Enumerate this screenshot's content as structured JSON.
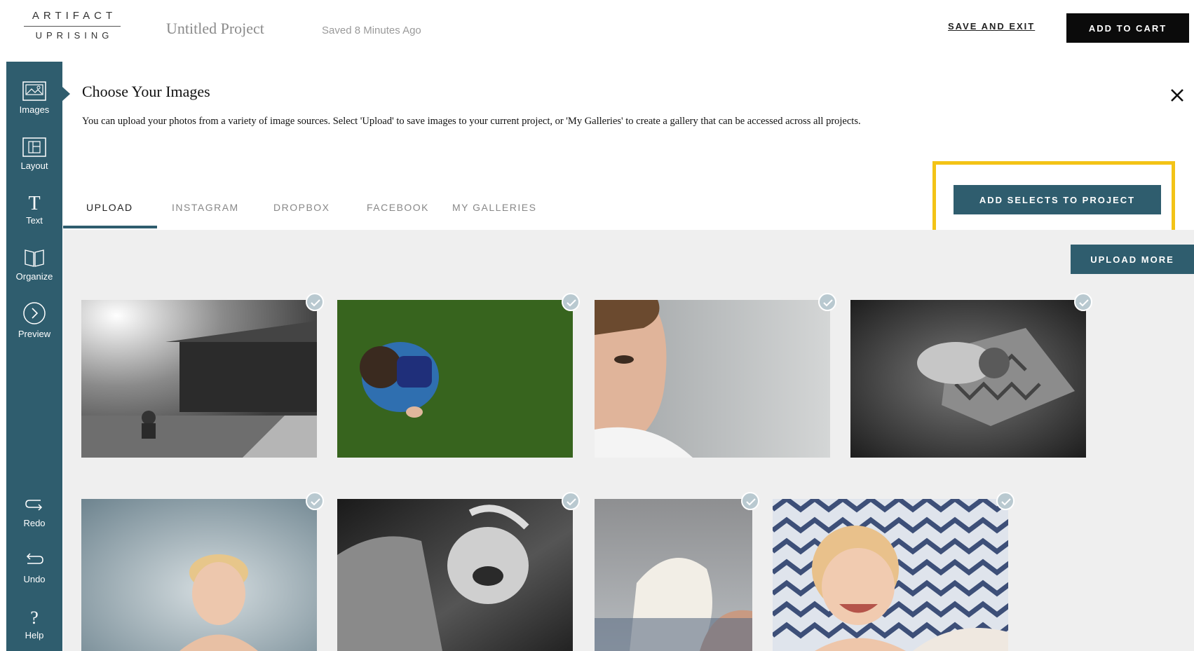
{
  "header": {
    "logo_line1": "ARTIFACT",
    "logo_line2": "UPRISING",
    "project_title": "Untitled Project",
    "saved_status": "Saved 8 Minutes Ago",
    "save_exit_label": "SAVE AND EXIT",
    "add_to_cart_label": "ADD TO CART"
  },
  "sidebar": {
    "items": [
      {
        "label": "Images",
        "icon": "image-icon"
      },
      {
        "label": "Layout",
        "icon": "layout-icon"
      },
      {
        "label": "Text",
        "icon": "text-icon"
      },
      {
        "label": "Organize",
        "icon": "book-icon"
      },
      {
        "label": "Preview",
        "icon": "chevron-right-circle-icon"
      }
    ],
    "bottom_items": [
      {
        "label": "Redo",
        "icon": "redo-icon"
      },
      {
        "label": "Undo",
        "icon": "undo-icon"
      },
      {
        "label": "Help",
        "icon": "help-icon"
      }
    ]
  },
  "panel": {
    "title": "Choose Your Images",
    "description": "You can upload your photos from a variety of image sources. Select 'Upload' to save images to your current project, or 'My Galleries' to create a gallery that can be accessed across all projects.",
    "close_icon": "close-icon"
  },
  "tabs": [
    {
      "label": "UPLOAD",
      "active": true
    },
    {
      "label": "INSTAGRAM",
      "active": false
    },
    {
      "label": "DROPBOX",
      "active": false
    },
    {
      "label": "FACEBOOK",
      "active": false
    },
    {
      "label": "MY GALLERIES",
      "active": false
    }
  ],
  "actions": {
    "add_selects_label": "ADD SELECTS TO PROJECT",
    "upload_more_label": "UPLOAD MORE",
    "highlight_color": "#f3c316"
  },
  "colors": {
    "accent": "#2f5d6e",
    "cart_button": "#0b0b0b",
    "gallery_bg": "#efefef",
    "check_badge": "#b9c9d0"
  },
  "photos": [
    {
      "description": "Black and white photo of child sitting on lawn in front of house",
      "selected": true
    },
    {
      "description": "Child in blue striped shirt sitting on green grass, seen from above",
      "selected": true
    },
    {
      "description": "Close-up of boy's face with grey wall",
      "selected": true
    },
    {
      "description": "Black and white photo of baby sleeping on chevron pillow",
      "selected": true
    },
    {
      "description": "Toddler against blue-grey backdrop",
      "selected": true
    },
    {
      "description": "Black and white photo of laughing child",
      "selected": true
    },
    {
      "description": "Child holding white towel",
      "selected": true
    },
    {
      "description": "Smiling toddler lying on chevron blanket",
      "selected": true
    }
  ]
}
